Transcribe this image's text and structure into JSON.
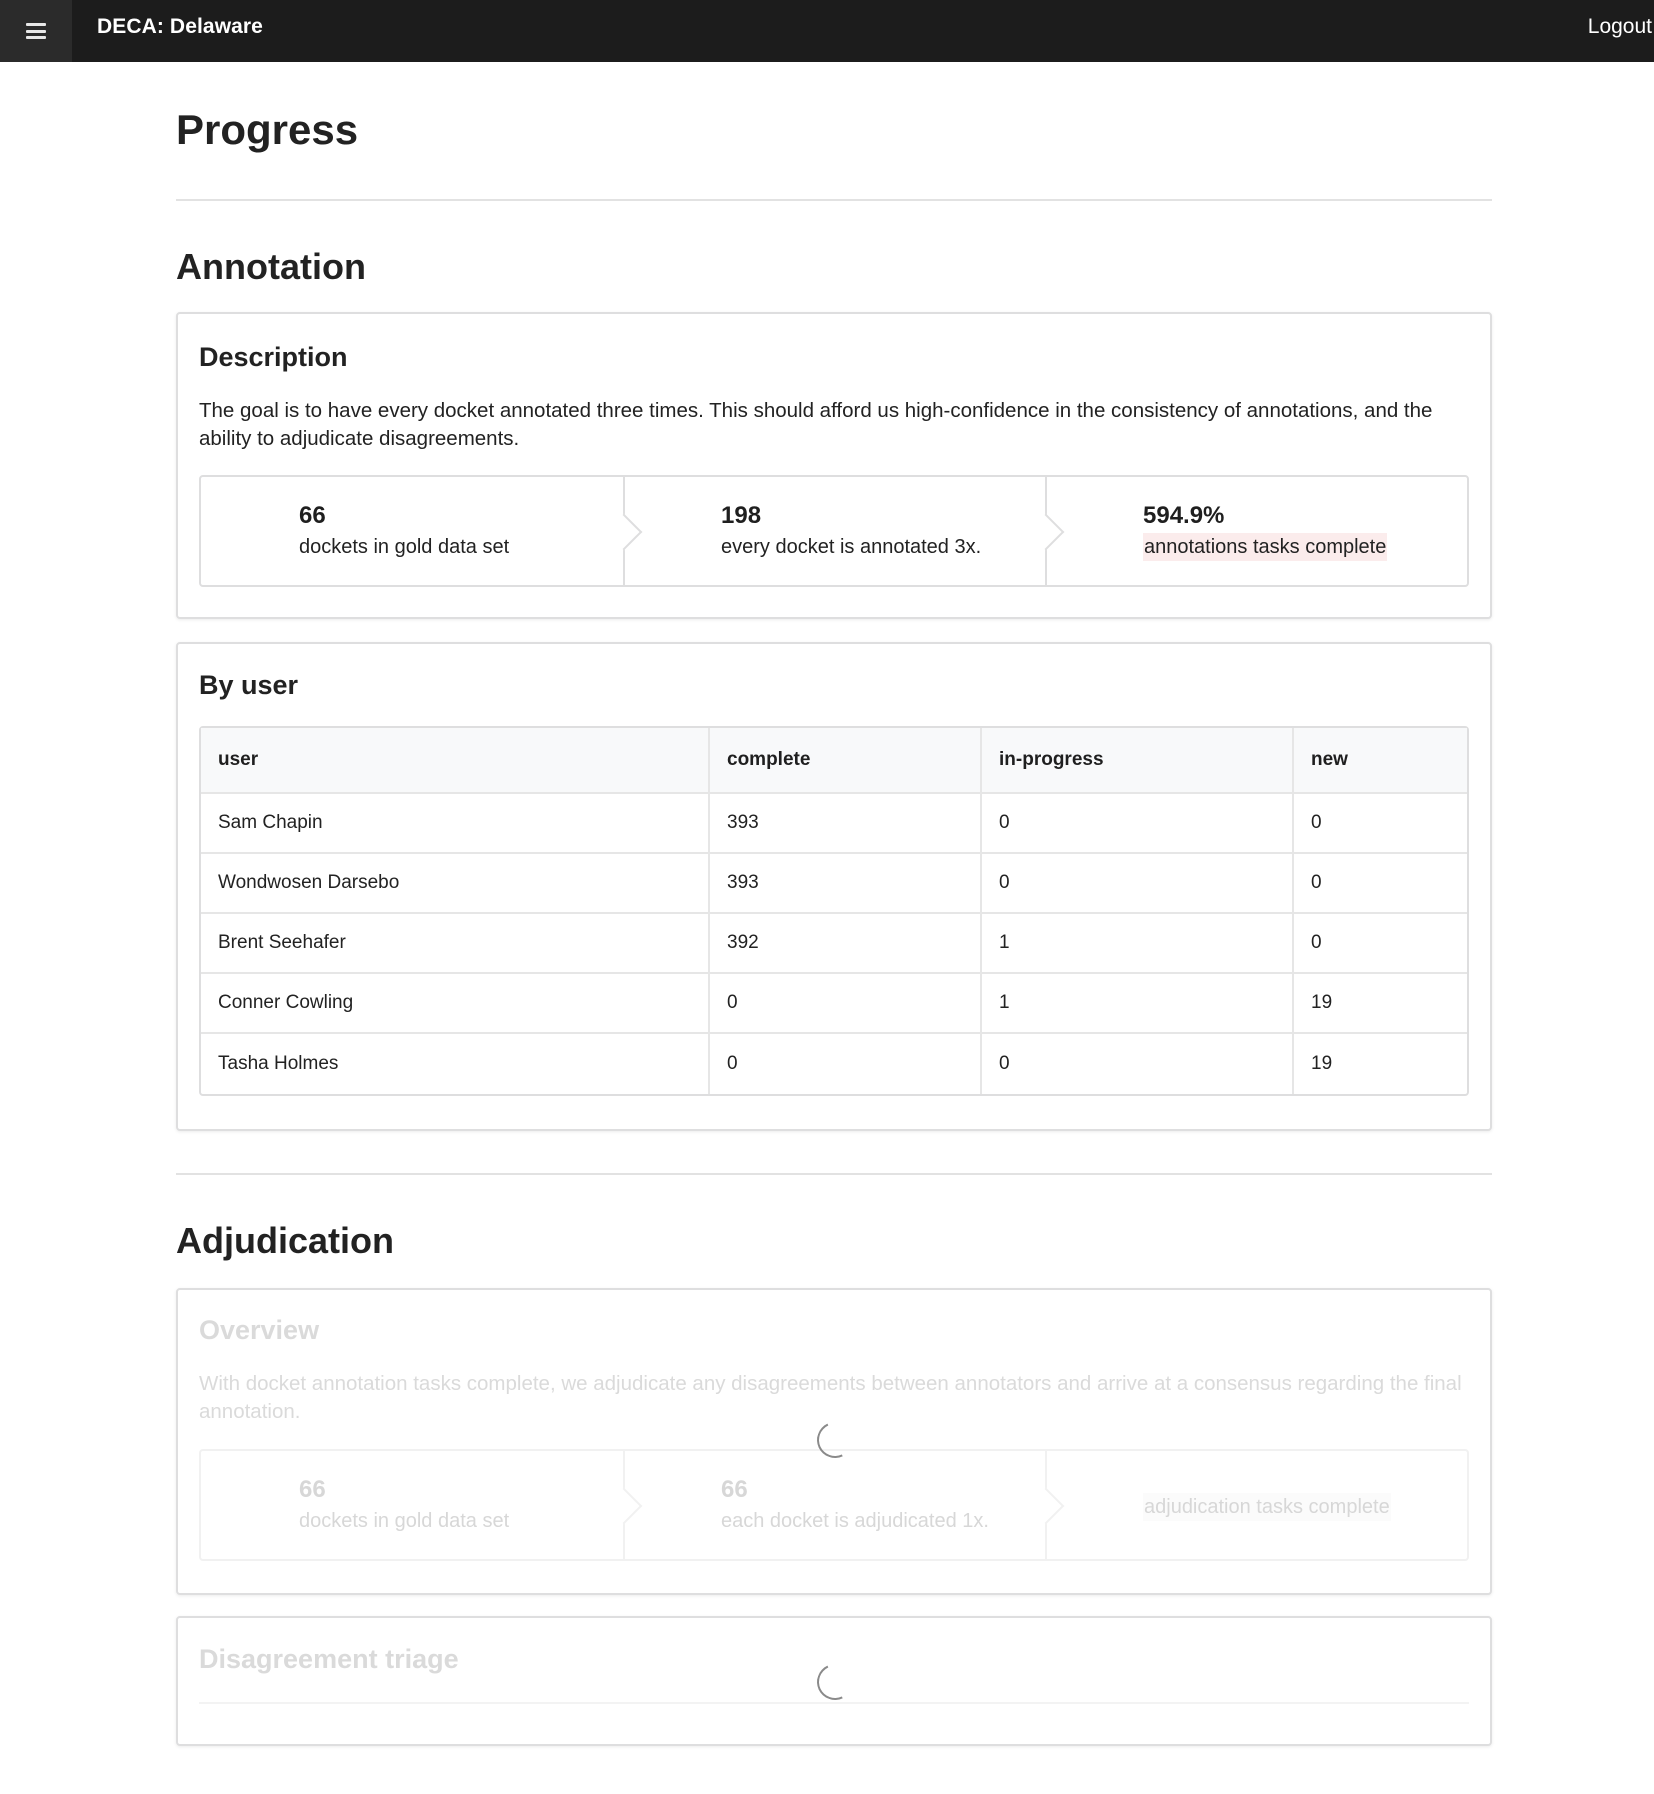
{
  "header": {
    "menu_icon": "hamburger-menu-icon",
    "app_title": "DECA: Delaware",
    "logout_label": "Logout"
  },
  "page": {
    "title": "Progress"
  },
  "annotation": {
    "section_title": "Annotation",
    "description": {
      "heading": "Description",
      "text": "The goal is to have every docket annotated three times. This should afford us high-confidence in the consistency of annotations, and the ability to adjudicate disagreements.",
      "steps": [
        {
          "value": "66",
          "label": "dockets in gold data set"
        },
        {
          "value": "198",
          "label": "every docket is annotated 3x."
        },
        {
          "value": "594.9%",
          "label": "annotations tasks complete"
        }
      ]
    },
    "by_user": {
      "heading": "By user",
      "columns": [
        "user",
        "complete",
        "in-progress",
        "new"
      ],
      "rows": [
        [
          "Sam Chapin",
          "393",
          "0",
          "0"
        ],
        [
          "Wondwosen Darsebo",
          "393",
          "0",
          "0"
        ],
        [
          "Brent Seehafer",
          "392",
          "1",
          "0"
        ],
        [
          "Conner Cowling",
          "0",
          "1",
          "19"
        ],
        [
          "Tasha Holmes",
          "0",
          "0",
          "19"
        ]
      ]
    }
  },
  "adjudication": {
    "section_title": "Adjudication",
    "overview": {
      "heading": "Overview",
      "text": "With docket annotation tasks complete, we adjudicate any disagreements between annotators and arrive at a consensus regarding the final annotation.",
      "steps": [
        {
          "value": "66",
          "label": "dockets in gold data set"
        },
        {
          "value": "66",
          "label": "each docket is adjudicated 1x."
        },
        {
          "value": "",
          "label": "adjudication tasks complete"
        }
      ]
    },
    "triage": {
      "heading": "Disagreement triage"
    }
  }
}
